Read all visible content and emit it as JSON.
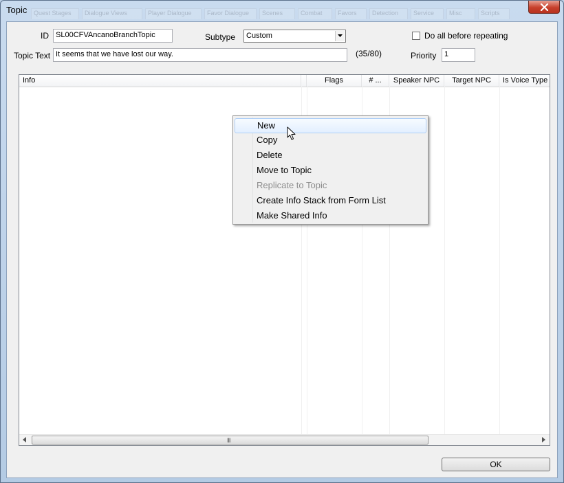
{
  "window": {
    "title": "Topic",
    "background_tabs": [
      "Quest Stages",
      "Dialogue Views",
      "Player Dialogue",
      "Favor Dialogue",
      "Scenes",
      "Combat",
      "Favors",
      "Detection",
      "Service",
      "Misc",
      "Scripts"
    ],
    "close_icon": "close-icon"
  },
  "form": {
    "id_label": "ID",
    "id_value": "SL00CFVAncanoBranchTopic",
    "subtype_label": "Subtype",
    "subtype_value": "Custom",
    "do_all_label": "Do all before repeating",
    "do_all_checked": false,
    "topic_text_label": "Topic Text",
    "topic_text_value": "It seems that we have lost our way.",
    "char_count": "(35/80)",
    "priority_label": "Priority",
    "priority_value": "1"
  },
  "info_list": {
    "columns": [
      "Info",
      "Flags",
      "# ...",
      "Speaker NPC",
      "Target NPC",
      "Is Voice Type"
    ],
    "rows": [],
    "hscroll_grip": "III"
  },
  "context_menu": {
    "items": [
      {
        "label": "New",
        "enabled": true,
        "highlighted": true
      },
      {
        "label": "Copy",
        "enabled": true
      },
      {
        "label": "Delete",
        "enabled": true
      },
      {
        "label": "Move to Topic",
        "enabled": true
      },
      {
        "label": "Replicate to Topic",
        "enabled": false
      },
      {
        "label": "Create Info Stack from Form List",
        "enabled": true
      },
      {
        "label": "Make Shared Info",
        "enabled": true
      }
    ]
  },
  "buttons": {
    "ok_label": "OK"
  }
}
